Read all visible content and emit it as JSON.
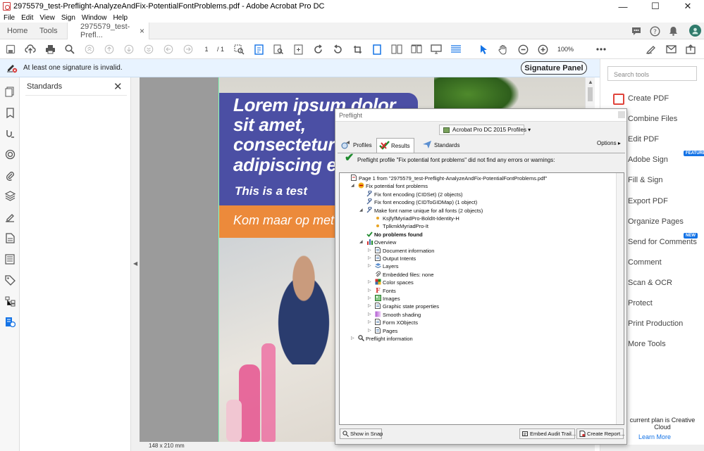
{
  "window": {
    "title": "2975579_test-Preflight-AnalyzeAndFix-PotentialFontProblems.pdf - Adobe Acrobat Pro DC",
    "controls": [
      "—",
      "☐",
      "✕"
    ]
  },
  "menu": [
    "File",
    "Edit",
    "View",
    "Sign",
    "Window",
    "Help"
  ],
  "tabs": {
    "home": "Home",
    "tools": "Tools",
    "document": "2975579_test-Prefl...",
    "close": "×"
  },
  "toolbar": {
    "page_current": "1",
    "page_count": "/ 1",
    "zoom": "100%"
  },
  "signature_banner": {
    "message": "At least one signature is invalid.",
    "button": "Signature Panel"
  },
  "standards_panel": {
    "title": "Standards",
    "close": "✕"
  },
  "page": {
    "headline": [
      "Lorem ipsum dolor",
      "sit amet,",
      "consectetur",
      "adipiscing e"
    ],
    "subheadline": "This is a test",
    "orange_text": "Kom maar op met",
    "size_label": "148 x 210 mm"
  },
  "right_tools": {
    "search_placeholder": "Search tools",
    "items": [
      {
        "label": "Create PDF",
        "color": "#e0433a"
      },
      {
        "label": "Combine Files",
        "color": "#7f5bd1"
      },
      {
        "label": "Edit PDF",
        "color": "#e0433a"
      },
      {
        "label": "Adobe Sign",
        "color": "#7f5bd1",
        "badge": "FEATURED"
      },
      {
        "label": "Fill & Sign",
        "color": "#7f5bd1"
      },
      {
        "label": "Export PDF",
        "color": "#e0433a"
      },
      {
        "label": "Organize Pages",
        "color": "#3b9b4a"
      },
      {
        "label": "Send for Comments",
        "color": "#e8a423",
        "badge": "NEW"
      },
      {
        "label": "Comment",
        "color": "#e8a423"
      },
      {
        "label": "Scan & OCR",
        "color": "#e0433a"
      },
      {
        "label": "Protect",
        "color": "#3b6fd1"
      },
      {
        "label": "Print Production",
        "color": "#3b6fd1"
      },
      {
        "label": "More Tools",
        "color": "#666666"
      }
    ],
    "plan_text": "current plan is Creative Cloud",
    "learn_more": "Learn More"
  },
  "preflight": {
    "title": "Preflight",
    "profile_select": "Acrobat Pro DC 2015 Profiles",
    "tabs": {
      "profiles": "Profiles",
      "results": "Results",
      "standards": "Standards"
    },
    "options": "Options",
    "summary": "Preflight profile \"Fix potential font problems\" did not find any errors or warnings:",
    "tree": [
      {
        "text": "Page 1 from \"2975579_test-Preflight-AnalyzeAndFix-PotentialFontProblems.pdf\"",
        "depth": 0,
        "expander": "",
        "icon": "page"
      },
      {
        "text": "Fix potential font problems",
        "depth": 1,
        "expander": "◢",
        "icon": "fix"
      },
      {
        "text": "Fix font encoding (CIDSet) (2 objects)",
        "depth": 2,
        "expander": "",
        "icon": "wrench"
      },
      {
        "text": "Fix font encoding (CIDToGIDMap) (1 object)",
        "depth": 2,
        "expander": "",
        "icon": "wrench"
      },
      {
        "text": "Make font name unique for all fonts (2 objects)",
        "depth": 2,
        "expander": "◢",
        "icon": "wrench"
      },
      {
        "text": "KsjfyfMyriadPro-BoldIt-Identity-H",
        "depth": 3,
        "expander": "",
        "icon": "dot"
      },
      {
        "text": "TplkmkMyriadPro-It",
        "depth": 3,
        "expander": "",
        "icon": "dot"
      },
      {
        "text": "No problems found",
        "depth": 2,
        "expander": "",
        "icon": "check",
        "bold": true
      },
      {
        "text": "Overview",
        "depth": 2,
        "expander": "◢",
        "icon": "chart"
      },
      {
        "text": "Document information",
        "depth": 3,
        "expander": "▷",
        "icon": "doc"
      },
      {
        "text": "Output Intents",
        "depth": 3,
        "expander": "▷",
        "icon": "doc"
      },
      {
        "text": "Layers",
        "depth": 3,
        "expander": "▷",
        "icon": "layers"
      },
      {
        "text": "Embedded files: none",
        "depth": 3,
        "expander": "",
        "icon": "clip"
      },
      {
        "text": "Color spaces",
        "depth": 3,
        "expander": "▷",
        "icon": "color"
      },
      {
        "text": "Fonts",
        "depth": 3,
        "expander": "▷",
        "icon": "font"
      },
      {
        "text": "Images",
        "depth": 3,
        "expander": "▷",
        "icon": "image"
      },
      {
        "text": "Graphic state properties",
        "depth": 3,
        "expander": "▷",
        "icon": "doc"
      },
      {
        "text": "Smooth shading",
        "depth": 3,
        "expander": "▷",
        "icon": "shade"
      },
      {
        "text": "Form XObjects",
        "depth": 3,
        "expander": "▷",
        "icon": "doc"
      },
      {
        "text": "Pages",
        "depth": 3,
        "expander": "▷",
        "icon": "doc"
      },
      {
        "text": "Preflight information",
        "depth": 1,
        "expander": "▷",
        "icon": "search"
      }
    ],
    "footer": {
      "show_in_snap": "Show in Snap",
      "embed_audit": "Embed Audit Trail...",
      "create_report": "Create Report..."
    }
  },
  "icons": {
    "home_tab": "",
    "comment": "comment-icon",
    "help": "help-icon",
    "bell": "bell-icon",
    "avatar": "avatar-icon"
  }
}
